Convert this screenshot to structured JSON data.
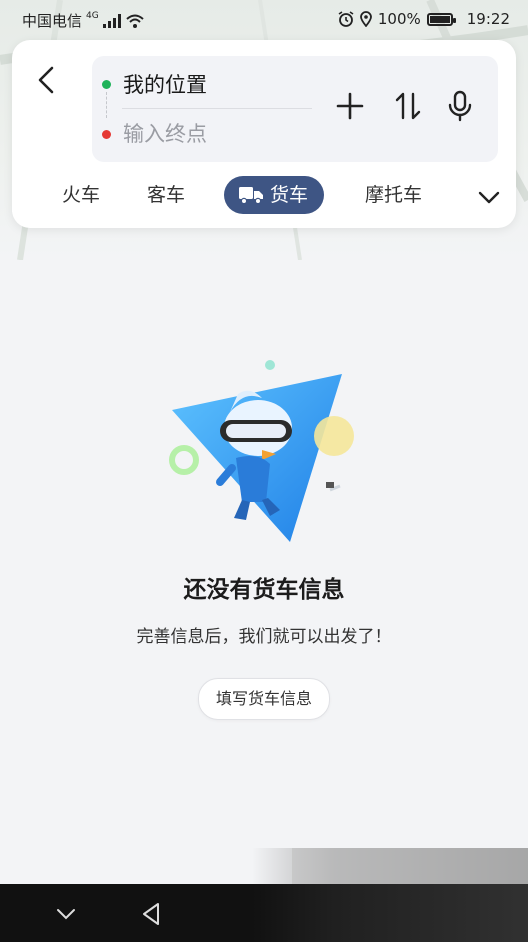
{
  "status_bar": {
    "carrier": "中国电信",
    "network": "4G",
    "battery": "100%",
    "time": "19:22"
  },
  "route": {
    "start": "我的位置",
    "end_placeholder": "输入终点",
    "start_dot_color": "#1fb35a",
    "end_dot_color": "#e53935"
  },
  "tabs": [
    {
      "label": "火车"
    },
    {
      "label": "客车"
    },
    {
      "label": "货车",
      "active": true
    },
    {
      "label": "摩托车"
    }
  ],
  "colors": {
    "active_tab": "#3e5584"
  },
  "empty_state": {
    "title": "还没有货车信息",
    "subtitle": "完善信息后，我们就可以出发了！",
    "action_label": "填写货车信息"
  },
  "icons": [
    "back-arrow-icon",
    "add-icon",
    "swap-icon",
    "microphone-icon",
    "truck-icon",
    "chevron-down-icon",
    "nav-back-icon",
    "nav-down-icon"
  ]
}
